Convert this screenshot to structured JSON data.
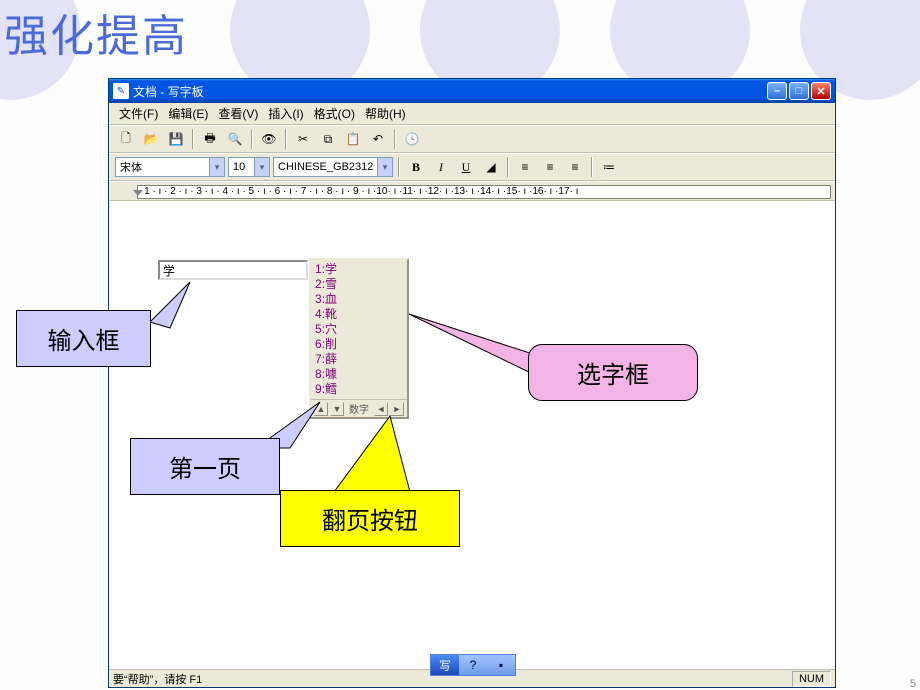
{
  "slide_title": "强化提高",
  "titlebar": {
    "title": "文档 - 写字板"
  },
  "menus": {
    "file": "文件(F)",
    "edit": "编辑(E)",
    "view": "查看(V)",
    "insert": "插入(I)",
    "format": "格式(O)",
    "help": "帮助(H)"
  },
  "toolbar_icons": {
    "new": "🗋",
    "open": "📂",
    "save": "💾",
    "print": "🖶",
    "preview": "🔍",
    "find": "👁",
    "cut": "✂",
    "copy": "⧉",
    "paste": "📋",
    "undo": "↶",
    "date": "🕓"
  },
  "format": {
    "font": "宋体",
    "size": "10",
    "script": "CHINESE_GB2312",
    "bold": "B",
    "italic": "I",
    "underline": "U",
    "color": "◢",
    "align_left": "≡",
    "align_center": "≡",
    "align_right": "≡",
    "bullets": "≔"
  },
  "ruler_text": " · 1 · ı · 2 · ı · 3 · ı · 4 · ı · 5 · ı · 6 · ı · 7 · ı · 8 · ı · 9 · ı ·10· ı ·11· ı ·12· ı ·13· ı ·14· ı ·15· ı ·16· ı ·17· ı",
  "ime": {
    "composition": "学",
    "candidates": [
      {
        "n": "1",
        "c": "学"
      },
      {
        "n": "2",
        "c": "雪"
      },
      {
        "n": "3",
        "c": "血"
      },
      {
        "n": "4",
        "c": "靴"
      },
      {
        "n": "5",
        "c": "穴"
      },
      {
        "n": "6",
        "c": "削"
      },
      {
        "n": "7",
        "c": "薛"
      },
      {
        "n": "8",
        "c": "噱"
      },
      {
        "n": "9",
        "c": "鳕"
      }
    ],
    "footer_label": "数字",
    "up": "▲",
    "down": "▼",
    "left": "◄",
    "right": "►"
  },
  "callouts": {
    "input": "输入框",
    "page1": "第一页",
    "select": "选字框",
    "pager": "翻页按钮"
  },
  "statusbar": {
    "help": "要“帮助”，请按 F1",
    "num": "NUM"
  },
  "lang_bar": {
    "a": "写",
    "b": "?",
    "c": "▪"
  },
  "pager": "5"
}
